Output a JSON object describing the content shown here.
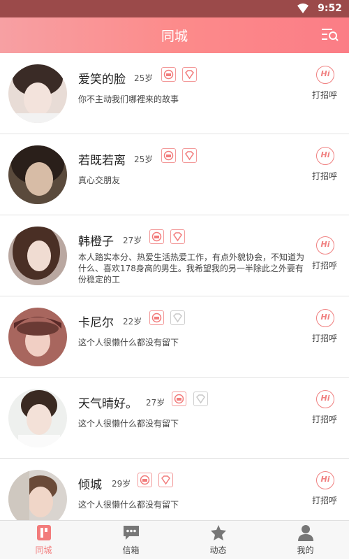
{
  "status_bar": {
    "time": "9:52"
  },
  "header": {
    "title": "同城"
  },
  "users": [
    {
      "name": "爱笑的脸",
      "age": "25岁",
      "signature": "你不主动我们哪裡来的故事",
      "vip": true,
      "diamond": true,
      "greet_label": "打招呼",
      "greet_icon": "Hi"
    },
    {
      "name": "若既若离",
      "age": "25岁",
      "signature": "真心交朋友",
      "vip": true,
      "diamond": true,
      "greet_label": "打招呼",
      "greet_icon": "Hi"
    },
    {
      "name": "韩橙子",
      "age": "27岁",
      "signature": "本人踏实本分、热爱生活热爱工作，有点外貌协会，不知道为什么、喜欢178身高的男生。我希望我的另一半除此之外要有份稳定的工",
      "vip": true,
      "diamond": true,
      "greet_label": "打招呼",
      "greet_icon": "Hi"
    },
    {
      "name": "卡尼尔",
      "age": "22岁",
      "signature": "这个人很懒什么都没有留下",
      "vip": true,
      "diamond": false,
      "greet_label": "打招呼",
      "greet_icon": "Hi"
    },
    {
      "name": "天气晴好。",
      "age": "27岁",
      "signature": "这个人很懒什么都没有留下",
      "vip": true,
      "diamond": false,
      "greet_label": "打招呼",
      "greet_icon": "Hi"
    },
    {
      "name": "倾城",
      "age": "29岁",
      "signature": "这个人很懒什么都没有留下",
      "vip": true,
      "diamond": true,
      "greet_label": "打招呼",
      "greet_icon": "Hi"
    }
  ],
  "tabs": [
    {
      "label": "同城",
      "icon": "nearby-icon",
      "active": true
    },
    {
      "label": "信箱",
      "icon": "message-icon",
      "active": false
    },
    {
      "label": "动态",
      "icon": "feed-star-icon",
      "active": false
    },
    {
      "label": "我的",
      "icon": "profile-icon",
      "active": false
    }
  ],
  "colors": {
    "accent": "#fc8b8b",
    "status_bar": "#9b4a4a",
    "active_tab": "#f27b7b"
  }
}
